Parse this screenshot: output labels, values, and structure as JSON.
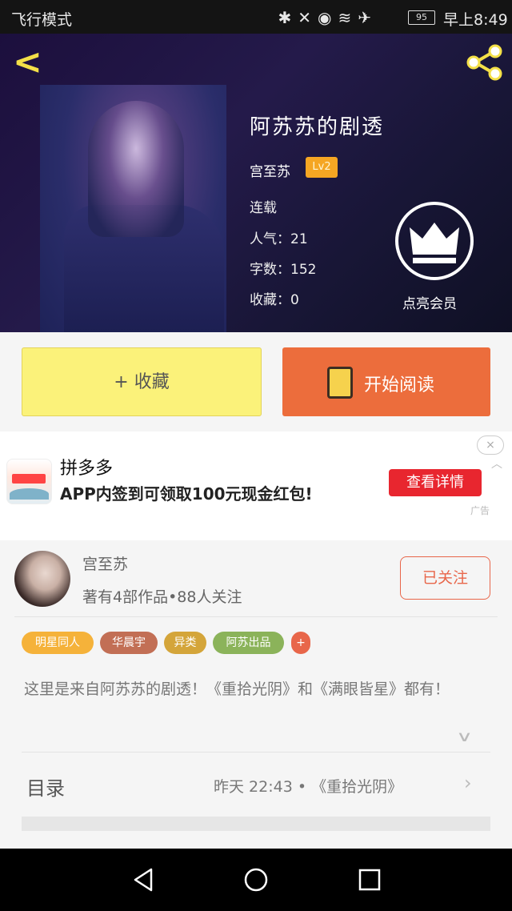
{
  "status_bar": {
    "mode": "飞行模式",
    "icons": [
      "bluetooth-icon",
      "mute-icon",
      "eye-icon",
      "wifi-icon",
      "airplane-icon"
    ],
    "battery": "95",
    "time": "早上8:49"
  },
  "book": {
    "title": "阿苏苏的剧透",
    "author": "宫至苏",
    "level": "Lv2",
    "status": "连载",
    "popularity": "人气：21",
    "word_count": "字数：152",
    "favorites": "收藏：0",
    "vip_label": "点亮会员"
  },
  "actions": {
    "favorite": "+ 收藏",
    "start_reading": "开始阅读"
  },
  "ad": {
    "app_name": "拼多多",
    "description": "APP内签到可领取100元现金红包!",
    "button": "查看详情",
    "close": "×",
    "tag": "广告"
  },
  "author_card": {
    "name": "宫至苏",
    "meta": "著有4部作品•88人关注",
    "follow_status": "已关注"
  },
  "tags": [
    {
      "label": "明星同人",
      "color": "#f5b23a"
    },
    {
      "label": "华晨宇",
      "color": "#c26f55"
    },
    {
      "label": "异类",
      "color": "#d4a53a"
    },
    {
      "label": "阿苏出品",
      "color": "#8bb35a"
    },
    {
      "label": "+",
      "color": "#e8664a"
    }
  ],
  "description": "这里是来自阿苏苏的剧透！《重拾光阴》和《满眼皆星》都有！",
  "toc": {
    "label": "目录",
    "latest": "昨天 22:43 • 《重拾光阴》"
  },
  "colors": {
    "accent_yellow": "#fbf27a",
    "accent_orange": "#ec6d3c",
    "ad_red": "#e8262f"
  }
}
